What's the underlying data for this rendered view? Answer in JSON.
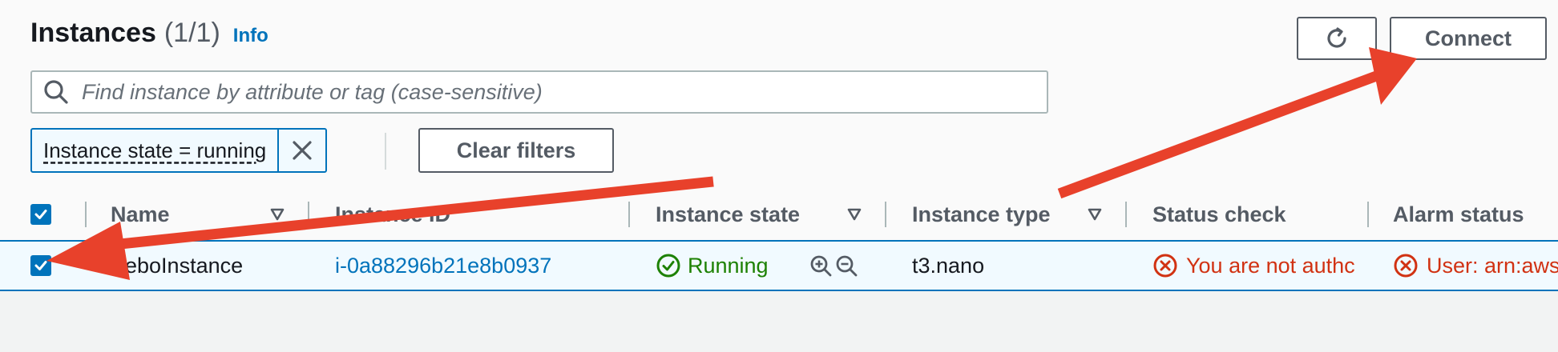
{
  "header": {
    "title": "Instances",
    "count": "(1/1)",
    "info": "Info",
    "refresh_icon": "refresh-icon",
    "connect_label": "Connect"
  },
  "search": {
    "placeholder": "Find instance by attribute or tag (case-sensitive)",
    "value": ""
  },
  "filters": {
    "token_label": "Instance state = running",
    "clear_label": "Clear filters"
  },
  "table": {
    "columns": [
      "Name",
      "Instance ID",
      "Instance state",
      "Instance type",
      "Status check",
      "Alarm status"
    ],
    "rows": [
      {
        "selected": true,
        "name": "AeboInstance",
        "instance_id": "i-0a88296b21e8b0937",
        "state": "Running",
        "type": "t3.nano",
        "status_check": "You are not authc",
        "alarm_status": "User: arn:aws"
      }
    ]
  },
  "colors": {
    "accent": "#0073bb",
    "running": "#1d8102",
    "error": "#d13212",
    "annotation_arrow": "#e8412b"
  }
}
